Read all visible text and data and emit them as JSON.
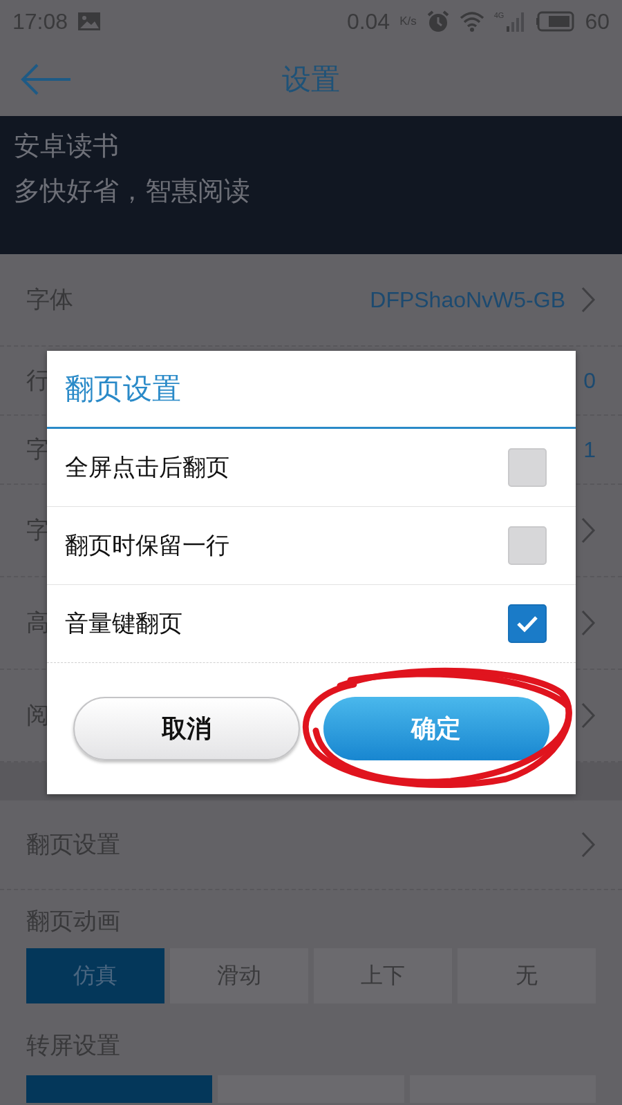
{
  "status_bar": {
    "time": "17:08",
    "speed": "0.04",
    "speed_unit": "K/s",
    "network": "4G",
    "battery": "60"
  },
  "header": {
    "title": "设置"
  },
  "banner": {
    "lines": [
      "安卓读书",
      "多快好省，智惠阅读"
    ]
  },
  "settings": [
    {
      "kind": "value",
      "label": "字体",
      "value": "DFPShaoNvW5-GB",
      "chevron": true
    },
    {
      "kind": "value",
      "label": "行",
      "value": "0",
      "chevron": false
    },
    {
      "kind": "value",
      "label": "字",
      "value": "1",
      "chevron": false
    },
    {
      "kind": "link",
      "label": "字",
      "chevron": true
    },
    {
      "kind": "link",
      "label": "高",
      "chevron": true
    },
    {
      "kind": "link",
      "label": "阅",
      "chevron": true
    }
  ],
  "page_turn_row": {
    "label": "翻页设置"
  },
  "animation": {
    "label": "翻页动画",
    "options": [
      {
        "label": "仿真",
        "selected": true
      },
      {
        "label": "滑动",
        "selected": false
      },
      {
        "label": "上下",
        "selected": false
      },
      {
        "label": "无",
        "selected": false
      }
    ]
  },
  "rotation": {
    "label": "转屏设置",
    "options": [
      {
        "selected": true
      },
      {
        "selected": false
      },
      {
        "selected": false
      }
    ]
  },
  "dialog": {
    "title": "翻页设置",
    "options": [
      {
        "label": "全屏点击后翻页",
        "checked": false
      },
      {
        "label": "翻页时保留一行",
        "checked": false
      },
      {
        "label": "音量键翻页",
        "checked": true
      }
    ],
    "buttons": [
      {
        "label": "取消",
        "kind": "secondary",
        "circled": false
      },
      {
        "label": "确定",
        "kind": "primary",
        "circled": true
      }
    ]
  }
}
